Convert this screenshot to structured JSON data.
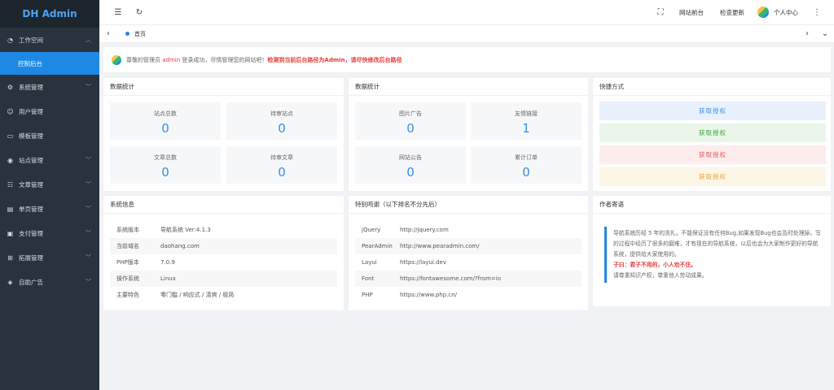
{
  "app": {
    "title": "DH Admin"
  },
  "sidebar": {
    "items": [
      {
        "label": "工作空间",
        "icon": "dashboard-icon",
        "expanded": true
      },
      {
        "label": "系统管理",
        "icon": "gear-icon"
      },
      {
        "label": "用户管理",
        "icon": "user-icon"
      },
      {
        "label": "模板管理",
        "icon": "template-icon"
      },
      {
        "label": "站点管理",
        "icon": "site-icon"
      },
      {
        "label": "文章管理",
        "icon": "article-icon"
      },
      {
        "label": "单页管理",
        "icon": "page-icon"
      },
      {
        "label": "支付管理",
        "icon": "pay-icon"
      },
      {
        "label": "拓展管理",
        "icon": "extend-icon"
      },
      {
        "label": "自助广告",
        "icon": "ad-icon"
      }
    ],
    "sub_active": "控制后台"
  },
  "topbar": {
    "site_front": "网站前台",
    "check_update": "检查更新",
    "user_center": "个人中心"
  },
  "tabs": [
    {
      "label": "首页"
    }
  ],
  "notice": {
    "prefix": "尊敬的管理员",
    "user": "admin",
    "middle": "登录成功，尽情管理您的网站吧！",
    "warning": "检测到当前后台路径为Admin，请尽快修改后台路径"
  },
  "stats1": {
    "title": "数据统计",
    "items": [
      {
        "label": "站点总数",
        "value": "0"
      },
      {
        "label": "待审站点",
        "value": "0"
      },
      {
        "label": "文章总数",
        "value": "0"
      },
      {
        "label": "待审文章",
        "value": "0"
      }
    ]
  },
  "stats2": {
    "title": "数据统计",
    "items": [
      {
        "label": "图片广告",
        "value": "0"
      },
      {
        "label": "友情链接",
        "value": "1"
      },
      {
        "label": "网站公告",
        "value": "0"
      },
      {
        "label": "累计订单",
        "value": "0"
      }
    ]
  },
  "quick": {
    "title": "快捷方式",
    "buttons": [
      {
        "label": "获取授权",
        "bg": "#e8f1fd",
        "color": "#3a8ee6"
      },
      {
        "label": "获取授权",
        "bg": "#eaf6ea",
        "color": "#36a636"
      },
      {
        "label": "获取授权",
        "bg": "#fdecec",
        "color": "#e05a5a"
      },
      {
        "label": "获取授权",
        "bg": "#fdf5e6",
        "color": "#e6a23c"
      }
    ]
  },
  "sysinfo": {
    "title": "系统信息",
    "rows": [
      {
        "k": "系统版本",
        "v": "导航系统 Ver:4.1.3"
      },
      {
        "k": "当前域名",
        "v": "daohang.com"
      },
      {
        "k": "PHP版本",
        "v": "7.0.9"
      },
      {
        "k": "操作系统",
        "v": "Linux"
      },
      {
        "k": "主要特色",
        "v": "零门槛 / 响应式 / 清爽 / 极简"
      }
    ]
  },
  "thanks": {
    "title": "特别鸣谢（以下排名不分先后）",
    "rows": [
      {
        "k": "jQuery",
        "v": "http://jquery.com"
      },
      {
        "k": "PearAdmin",
        "v": "http://www.pearadmin.com/"
      },
      {
        "k": "Layui",
        "v": "https://layui.dev"
      },
      {
        "k": "Font",
        "v": "https://fontawesome.com/?from=io"
      },
      {
        "k": "PHP",
        "v": "https://www.php.cn/"
      }
    ]
  },
  "author": {
    "title": "作者寄语",
    "p1": "导航系统历经 5 年的洗礼，不能保证没有任何Bug,如果发现Bug也会及时处理掉，写的过程中经历了很多的磨难，才有现在的导航系统，以后也会为大家制作更好的导航系统，提供给大家使用的。",
    "p2": "子曰：君子不用的，小人劝不住。",
    "p3": "请尊重知识产权，尊重他人劳动成果。"
  }
}
